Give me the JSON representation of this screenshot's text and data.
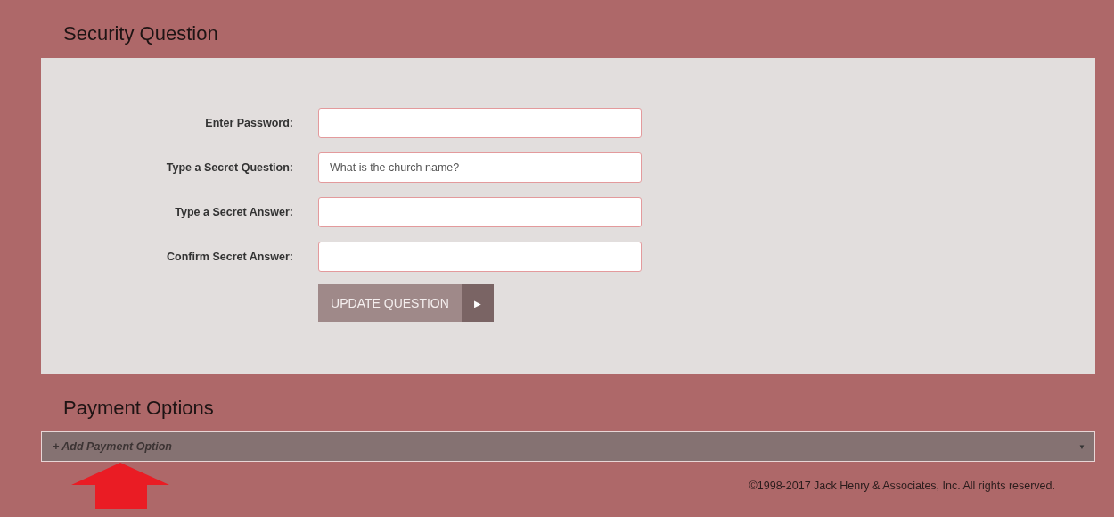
{
  "security_question": {
    "title": "Security Question",
    "fields": [
      {
        "label": "Enter Password:"
      },
      {
        "label": "Type a Secret Question:",
        "value": "What is the church name?"
      },
      {
        "label": "Type a Secret Answer:"
      },
      {
        "label": "Confirm Secret Answer:"
      }
    ],
    "button": {
      "label": "UPDATE QUESTION",
      "arrow": "▶"
    }
  },
  "payment_options": {
    "title": "Payment Options",
    "dropdown": {
      "value": "+ Add Payment Option",
      "caret": "▼"
    }
  },
  "footer": "©1998-2017 Jack Henry & Associates, Inc. All rights reserved."
}
